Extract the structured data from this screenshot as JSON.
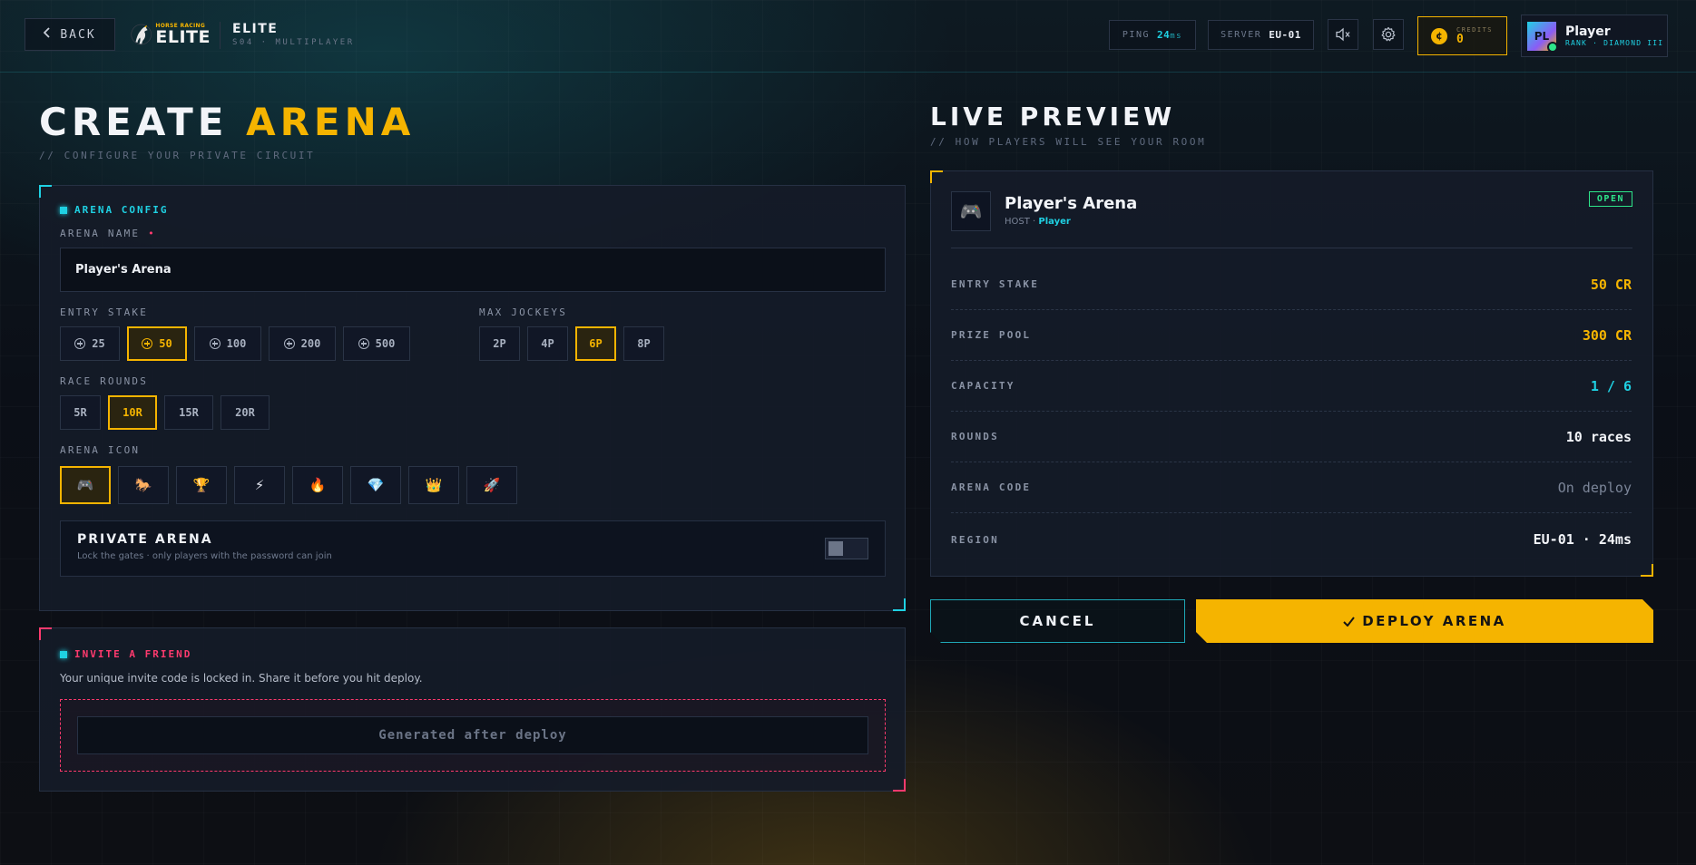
{
  "header": {
    "back_label": "BACK",
    "logo_small": "HORSE RACING",
    "logo_big": "ELITE",
    "title": "ELITE",
    "subtitle": "S04 · MULTIPLAYER",
    "ping_label": "PING",
    "ping_value": "24",
    "ping_unit": "ms",
    "server_label": "SERVER",
    "server_value": "EU-01",
    "credits_label": "CREDITS",
    "credits_value": "0",
    "player_initials": "PL",
    "player_name": "Player",
    "player_rank": "RANK · DIAMOND III"
  },
  "create": {
    "title_a": "CREATE",
    "title_b": "ARENA",
    "subtitle": "// CONFIGURE YOUR PRIVATE CIRCUIT"
  },
  "config": {
    "section_title": "ARENA CONFIG",
    "name_label": "ARENA NAME",
    "name_value": "Player's Arena",
    "stake_label": "ENTRY STAKE",
    "stakes": [
      "25",
      "50",
      "100",
      "200",
      "500"
    ],
    "jockeys_label": "MAX JOCKEYS",
    "jockeys": [
      "2P",
      "4P",
      "6P",
      "8P"
    ],
    "rounds_label": "RACE ROUNDS",
    "rounds": [
      "5R",
      "10R",
      "15R",
      "20R"
    ],
    "icon_label": "ARENA ICON",
    "icons": [
      "🎮",
      "🐎",
      "🏆",
      "⚡",
      "🔥",
      "💎",
      "👑",
      "🚀"
    ],
    "private_title": "PRIVATE ARENA",
    "private_desc": "Lock the gates · only players with the password can join",
    "private_enabled": false
  },
  "invite": {
    "section_title": "INVITE A FRIEND",
    "text": "Your unique invite code is locked in. Share it before you hit deploy.",
    "code_placeholder": "Generated after deploy"
  },
  "preview": {
    "title": "LIVE PREVIEW",
    "subtitle": "// HOW PLAYERS WILL SEE YOUR ROOM",
    "icon": "🎮",
    "arena_name": "Player's Arena",
    "host_label": "HOST ·",
    "host_name": "Player",
    "status": "OPEN",
    "stats": [
      {
        "key": "ENTRY STAKE",
        "value": "50 CR",
        "color": "#f5b400"
      },
      {
        "key": "PRIZE POOL",
        "value": "300 CR",
        "color": "#f5b400"
      },
      {
        "key": "CAPACITY",
        "value": "1 / 6",
        "color": "#1fd1e3"
      },
      {
        "key": "ROUNDS",
        "value": "10 races",
        "color": "#f2f4f8"
      },
      {
        "key": "ARENA CODE",
        "value": "On deploy",
        "color": "#7b8598"
      },
      {
        "key": "REGION",
        "value": "EU-01 · 24ms",
        "color": "#f2f4f8"
      }
    ]
  },
  "actions": {
    "cancel_label": "CANCEL",
    "deploy_label": "DEPLOY ARENA"
  },
  "colors": {
    "accent": "#f5b400",
    "cyan": "#1fd1e3",
    "pink": "#ff3a6e",
    "green": "#2ee58a"
  }
}
